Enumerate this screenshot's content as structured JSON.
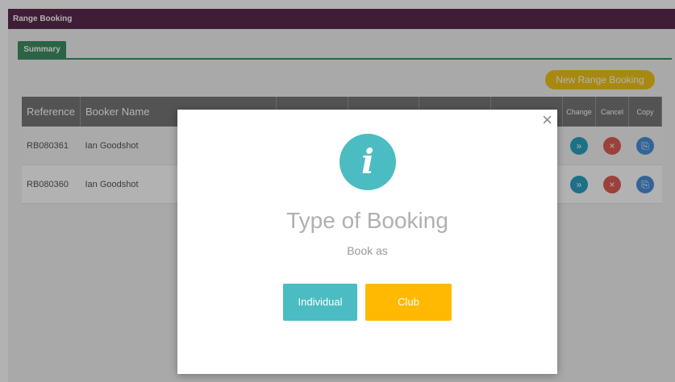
{
  "header": {
    "title": "Range Booking"
  },
  "tabs": [
    {
      "label": "Summary"
    }
  ],
  "actions": {
    "new_booking_label": "New Range Booking"
  },
  "table": {
    "columns": [
      "Reference",
      "Booker Name",
      "Change",
      "Cancel",
      "Copy"
    ],
    "rows": [
      {
        "reference": "RB080361",
        "booker": "Ian Goodshot"
      },
      {
        "reference": "RB080360",
        "booker": "Ian Goodshot"
      }
    ]
  },
  "modal": {
    "close_glyph": "×",
    "info_glyph": "i",
    "title": "Type of Booking",
    "subtitle": "Book as",
    "buttons": {
      "individual": "Individual",
      "club": "Club"
    }
  },
  "icons": {
    "change": "change-icon",
    "cancel": "cancel-icon",
    "copy": "copy-icon",
    "info": "info-icon",
    "close": "close-icon"
  },
  "colors": {
    "header_bg": "#5b2a4e",
    "tab_green": "#3e8f63",
    "new_button": "#f0c419",
    "info_teal": "#4bbcc2",
    "club_orange": "#ffb900"
  }
}
